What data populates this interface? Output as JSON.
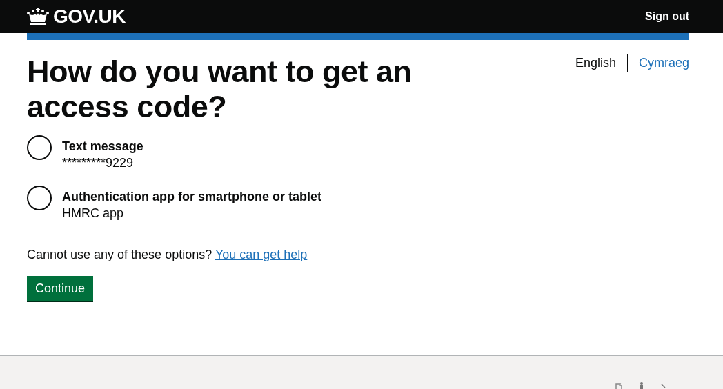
{
  "header": {
    "logo": "GOV.UK",
    "sign_out": "Sign out"
  },
  "languages": [
    {
      "label": "English",
      "selected": true
    },
    {
      "label": "Cymraeg",
      "selected": false
    }
  ],
  "title": "How do you want to get an access code?",
  "options": [
    {
      "label": "Text message",
      "hint": "*********9229",
      "selected": false
    },
    {
      "label": "Authentication app for smartphone or tablet",
      "hint": "HMRC app",
      "selected": false
    }
  ],
  "help": {
    "text": "Cannot use any of these options?",
    "link": "You can get help"
  },
  "button": "Continue"
}
